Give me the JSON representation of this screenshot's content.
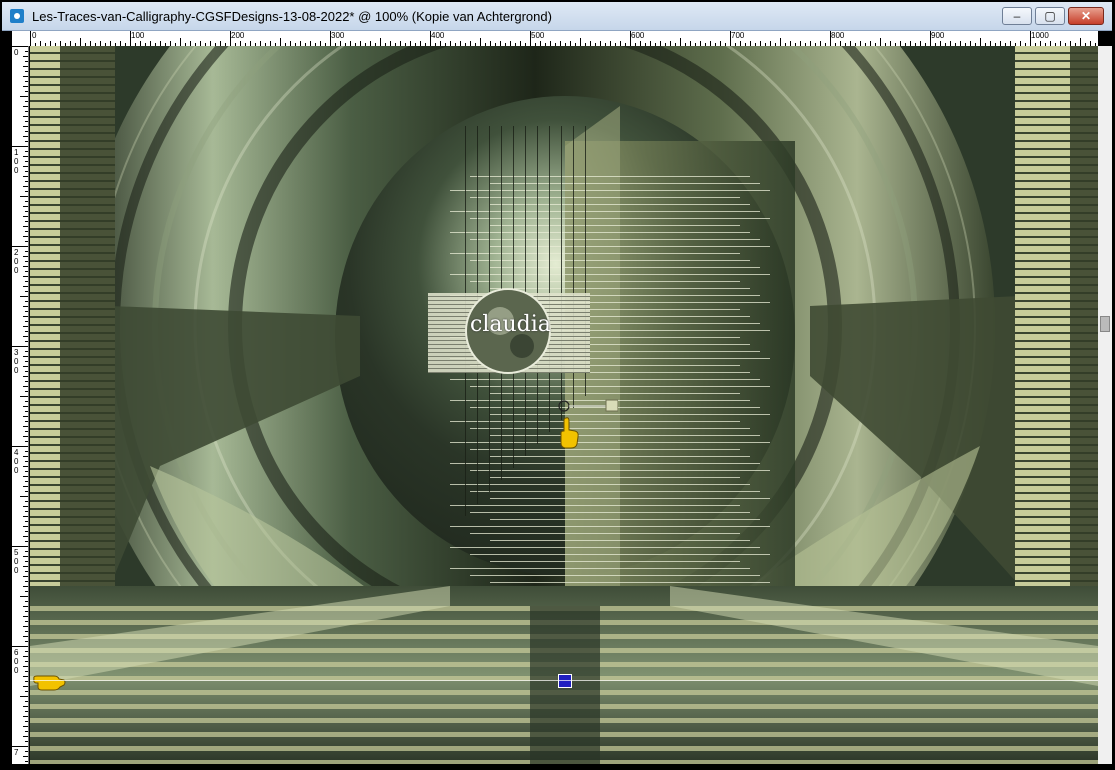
{
  "window": {
    "title": "Les-Traces-van-Calligraphy-CGSFDesigns-13-08-2022* @ 100% (Kopie van Achtergrond)",
    "minimize_glyph": "–",
    "maximize_glyph": "▢",
    "close_glyph": "✕"
  },
  "ruler_top": {
    "labels": [
      "0",
      "100",
      "200",
      "300",
      "400",
      "500",
      "600",
      "700",
      "800",
      "900",
      "1000"
    ]
  },
  "ruler_left": {
    "labels": [
      "0",
      "1 0 0",
      "2 0 0",
      "3 0 0",
      "4 0 0",
      "5 0 0",
      "6 0 0",
      "7"
    ]
  },
  "canvas": {
    "watermark_text": "claudia",
    "colors": {
      "dark_green": "#2d3d2a",
      "mid_green": "#6f8566",
      "light_green": "#c9d3a8",
      "pale_band": "#c8cc9a",
      "cursor_yellow": "#f2c200"
    }
  },
  "icons": {
    "pointer_hand": "hand-pointer-icon",
    "left_hand": "hand-left-icon",
    "app": "paintshop-icon"
  }
}
